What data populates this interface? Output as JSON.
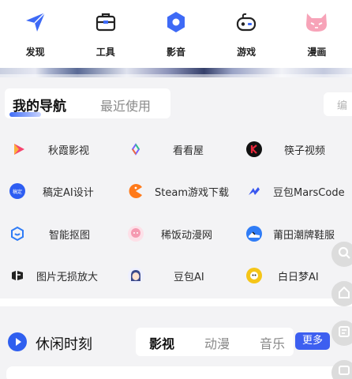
{
  "top_categories": [
    {
      "label": "发现",
      "icon": "paper-plane-icon",
      "color": "#3e6af6"
    },
    {
      "label": "工具",
      "icon": "toolbox-icon",
      "color": "#222222"
    },
    {
      "label": "影音",
      "icon": "hexagon-play-icon",
      "color": "#3e6af6"
    },
    {
      "label": "游戏",
      "icon": "gamepad-icon",
      "color": "#222222"
    },
    {
      "label": "漫画",
      "icon": "cat-icon",
      "color": "#f58ca9"
    }
  ],
  "nav": {
    "tab_mine": "我的导航",
    "tab_recent": "最近使用",
    "edit": "编",
    "items": [
      {
        "label": "秋霞影视",
        "icon": "play-triangle-icon",
        "color": "#f6446f"
      },
      {
        "label": "看看屋",
        "icon": "colorful-swirl-icon",
        "color": "#f06a3d"
      },
      {
        "label": "筷子视频",
        "icon": "k-logo-icon",
        "color": "#111111"
      },
      {
        "label": "稿定AI设计",
        "icon": "gaoding-logo-icon",
        "color": "#2d5df2"
      },
      {
        "label": "Steam游戏下载",
        "icon": "pacman-icon",
        "color": "#ff7a1a"
      },
      {
        "label": "豆包MarsCode",
        "icon": "marscode-logo-icon",
        "color": "#3957ef"
      },
      {
        "label": "智能抠图",
        "icon": "smart-cutout-icon",
        "color": "#2f7cf6"
      },
      {
        "label": "稀饭动漫网",
        "icon": "anime-avatar-icon",
        "color": "#f59ab1"
      },
      {
        "label": "莆田潮牌鞋服",
        "icon": "sneaker-icon",
        "color": "#2f7cf6"
      },
      {
        "label": "图片无损放大",
        "icon": "image-upscale-icon",
        "color": "#222222"
      },
      {
        "label": "豆包AI",
        "icon": "doubao-avatar-icon",
        "color": "#3b4a8a"
      },
      {
        "label": "白日梦AI",
        "icon": "daydream-icon",
        "color": "#f5c518"
      }
    ]
  },
  "leisure": {
    "title": "休闲时刻",
    "tabs": [
      "影视",
      "动漫",
      "音乐"
    ],
    "more": "更多",
    "accent": "#3d5ff0"
  },
  "side_buttons": [
    "search-icon",
    "home-icon",
    "list-icon",
    "message-icon"
  ]
}
